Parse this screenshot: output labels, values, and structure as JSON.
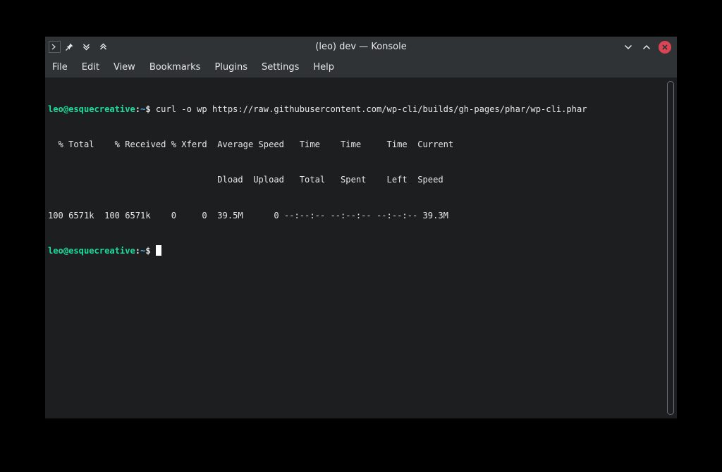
{
  "window": {
    "title": "(leo) dev — Konsole"
  },
  "menu": {
    "items": [
      "File",
      "Edit",
      "View",
      "Bookmarks",
      "Plugins",
      "Settings",
      "Help"
    ]
  },
  "terminal": {
    "prompt": {
      "user_host": "leo@esquecreative",
      "separator": ":",
      "path": "~",
      "symbol": "$"
    },
    "command": " curl -o wp https://raw.githubusercontent.com/wp-cli/builds/gh-pages/phar/wp-cli.phar",
    "output_lines": [
      "  % Total    % Received % Xferd  Average Speed   Time    Time     Time  Current",
      "                                 Dload  Upload   Total   Spent    Left  Speed",
      "100 6571k  100 6571k    0     0  39.5M      0 --:--:-- --:--:-- --:--:-- 39.3M"
    ]
  },
  "colors": {
    "background": "#1c1e1f",
    "titlebar": "#2f3336",
    "prompt_user": "#1cdc9a",
    "prompt_path": "#3daee9",
    "close_button": "#da4453"
  },
  "icons": {
    "app": "konsole-terminal-icon",
    "pin": "pin-icon",
    "keep_below": "chevron-double-down-icon",
    "keep_above": "chevron-double-up-icon",
    "minimize": "chevron-down-icon",
    "maximize": "chevron-up-icon",
    "close": "close-icon"
  }
}
